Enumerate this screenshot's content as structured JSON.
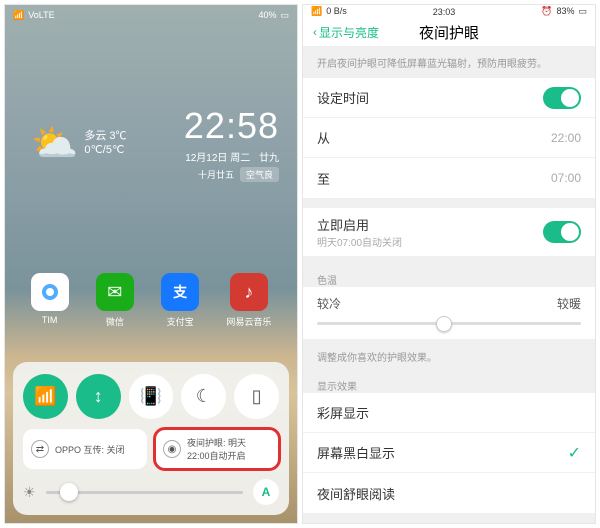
{
  "left": {
    "status": {
      "carrier": "VoLTE",
      "battery": "40%",
      "nettype": "4G"
    },
    "weather": {
      "icon": "⛅",
      "cond": "多云 3℃",
      "range": "0℃/5℃"
    },
    "clock": {
      "time": "22:58",
      "date": "12月12日 周二",
      "lunar": "十月廿五",
      "extra": "廿九",
      "air": "空气良"
    },
    "apps": [
      {
        "name": "TIM"
      },
      {
        "name": "微信"
      },
      {
        "name": "支付宝"
      },
      {
        "name": "网易云音乐"
      }
    ],
    "panel": {
      "info1_label": "OPPO 互传: 关闭",
      "info2_title": "夜间护眼: 明天",
      "info2_sub": "22:00自动开启"
    }
  },
  "right": {
    "status": {
      "net": "0 B/s",
      "time": "23:03",
      "battery": "83%"
    },
    "nav": {
      "back": "显示与亮度",
      "title": "夜间护眼"
    },
    "hint": "开启夜间护眼可降低屏幕蓝光辐射，预防用眼疲劳。",
    "rows": {
      "settime": "设定时间",
      "from": "从",
      "from_val": "22:00",
      "to": "至",
      "to_val": "07:00",
      "now": "立即启用",
      "now_sub": "明天07:00自动关闭"
    },
    "temp": {
      "label": "色温",
      "cold": "较冷",
      "warm": "较暖",
      "hint": "调整成你喜欢的护眼效果。"
    },
    "display": {
      "label": "显示效果",
      "r1": "彩屏显示",
      "r2": "屏幕黑白显示",
      "r3": "夜间舒眼阅读"
    }
  }
}
